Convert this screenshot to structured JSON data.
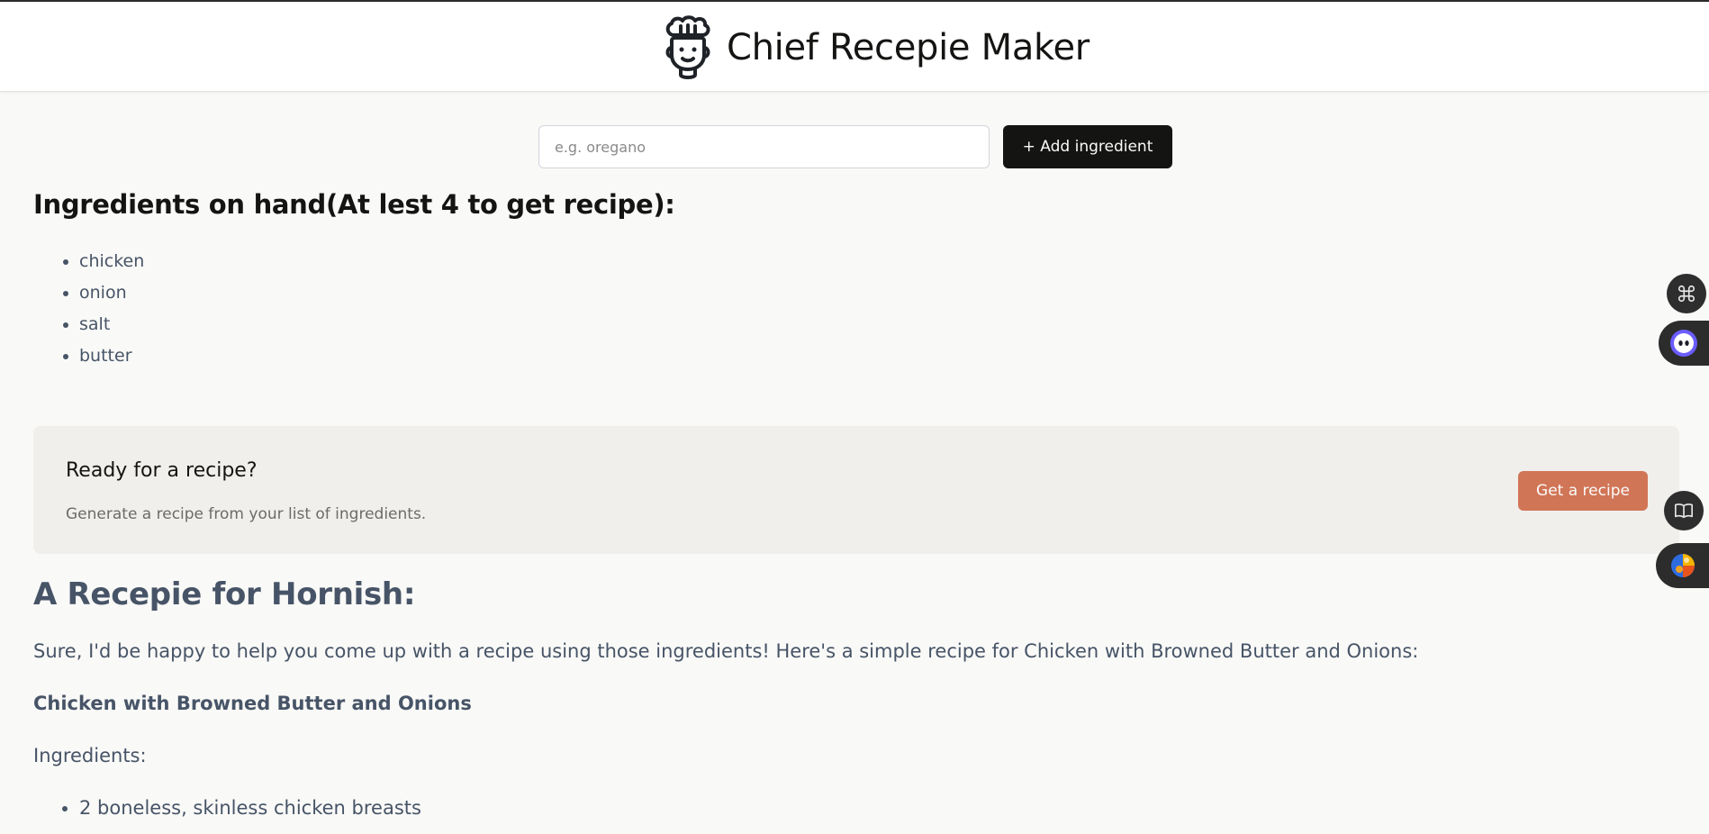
{
  "header": {
    "title": "Chief Recepie Maker",
    "logo_icon": "chef-hat-face-icon"
  },
  "add_form": {
    "input_placeholder": "e.g. oregano",
    "input_value": "",
    "add_button_label": "+ Add ingredient"
  },
  "ingredients": {
    "heading": "Ingredients on hand(At lest 4 to get recipe):",
    "items": [
      "chicken",
      "onion",
      "salt",
      "butter"
    ]
  },
  "cta": {
    "title": "Ready for a recipe?",
    "subtitle": "Generate a recipe from your list of ingredients.",
    "button_label": "Get a recipe",
    "button_color": "#d17557"
  },
  "recipe": {
    "heading": "A Recepie for Hornish:",
    "intro": "Sure, I'd be happy to help you come up with a recipe using those ingredients! Here's a simple recipe for Chicken with Browned Butter and Onions:",
    "dish_title": "Chicken with Browned Butter and Onions",
    "ingredients_label": "Ingredients:",
    "ingredient_items": [
      "2 boneless, skinless chicken breasts"
    ]
  },
  "side_widgets": [
    {
      "icon": "command-key-icon"
    },
    {
      "icon": "assistant-face-icon"
    },
    {
      "icon": "open-book-icon"
    },
    {
      "icon": "colorful-globe-icon"
    }
  ],
  "colors": {
    "page_background": "#f9f9f7",
    "primary_button": "#141413",
    "accent": "#d17557",
    "text_muted": "#475467",
    "panel_background": "#f0efeb"
  }
}
